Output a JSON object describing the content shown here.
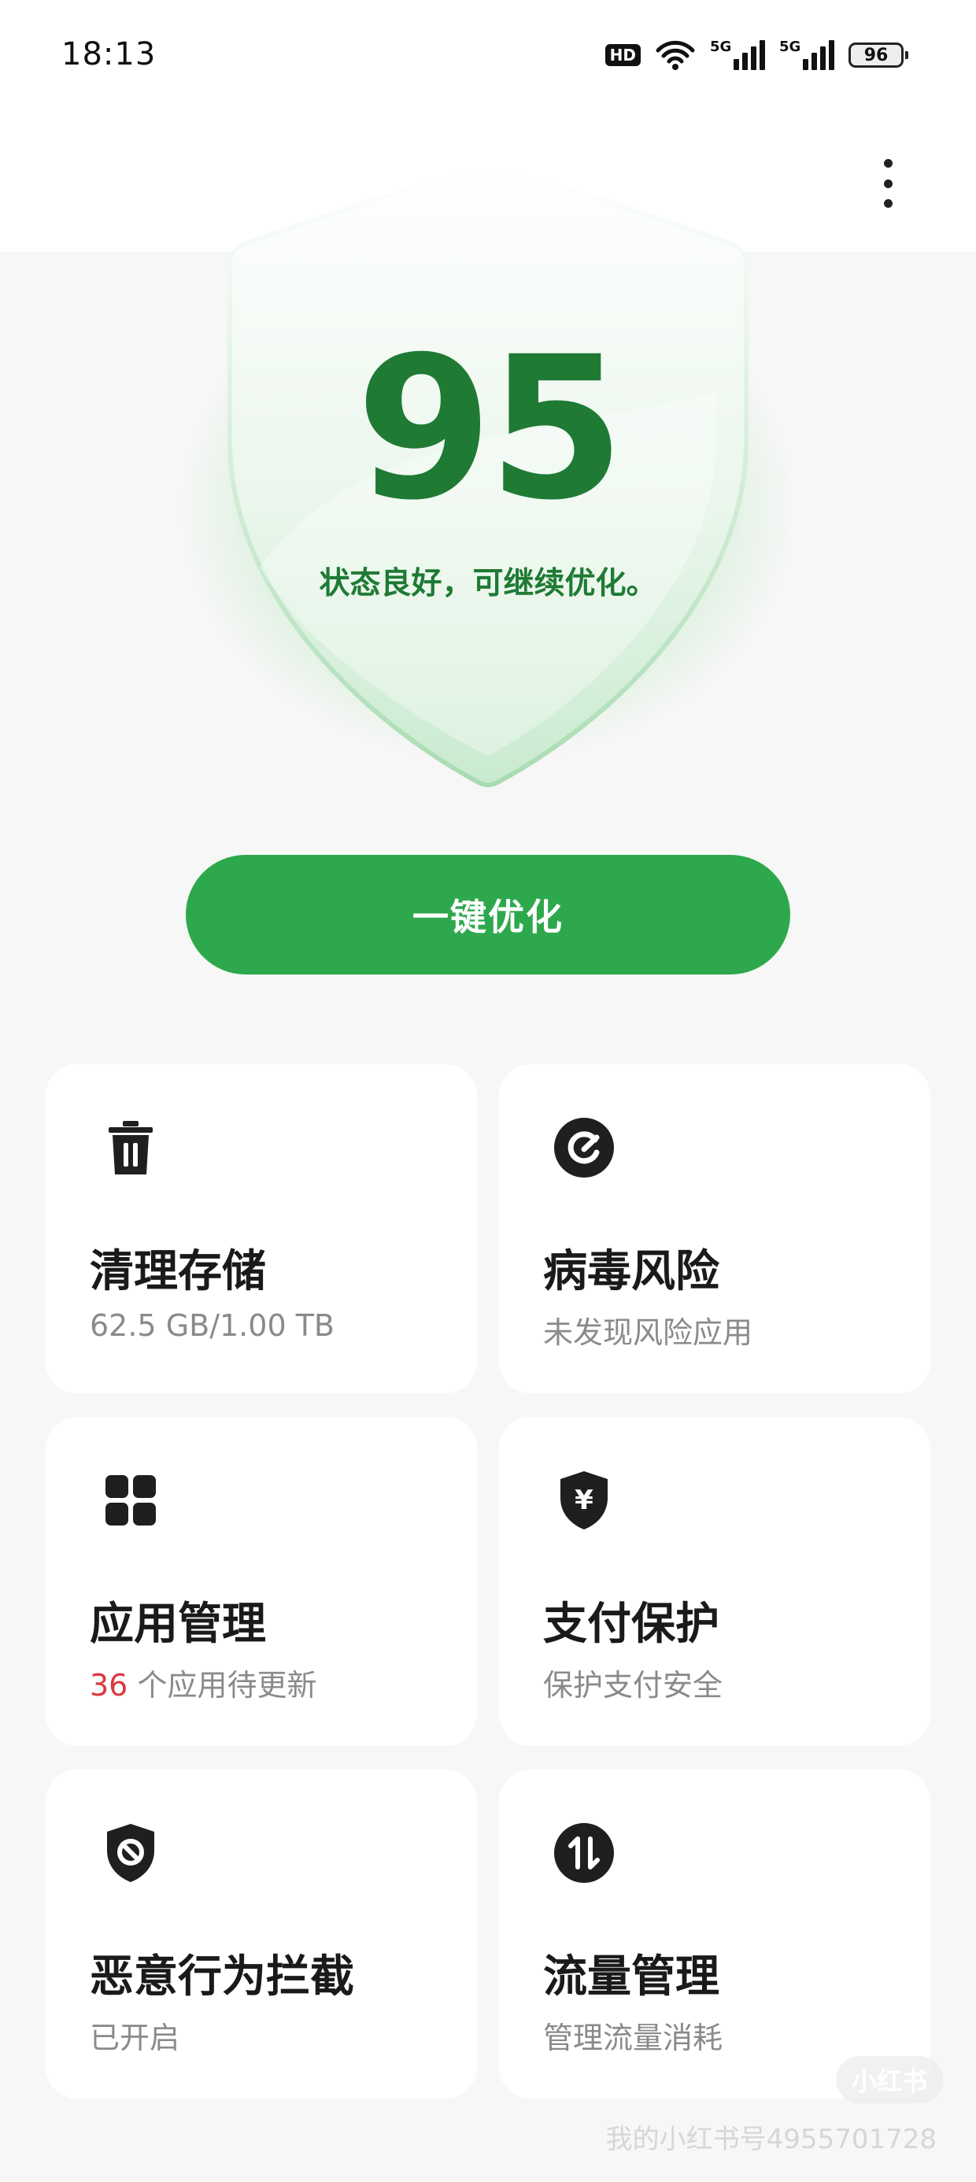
{
  "status_bar": {
    "time": "18:13",
    "hd_label": "HD",
    "network_1": "5G",
    "network_2": "5G",
    "battery": "96"
  },
  "shield": {
    "score": "95",
    "message": "状态良好，可继续优化。"
  },
  "optimize_button": {
    "label": "一键优化"
  },
  "cards": [
    {
      "title": "清理存储",
      "subtitle": "62.5 GB/1.00 TB",
      "icon": "trash-icon"
    },
    {
      "title": "病毒风险",
      "subtitle": "未发现风险应用",
      "icon": "virus-scan-icon"
    },
    {
      "title": "应用管理",
      "subtitle_count": "36",
      "subtitle": " 个应用待更新",
      "icon": "apps-grid-icon"
    },
    {
      "title": "支付保护",
      "subtitle": "保护支付安全",
      "icon": "payment-shield-icon"
    },
    {
      "title": "恶意行为拦截",
      "subtitle": "已开启",
      "icon": "block-shield-icon"
    },
    {
      "title": "流量管理",
      "subtitle": "管理流量消耗",
      "icon": "data-traffic-icon"
    }
  ],
  "watermark": {
    "logo": "小红书",
    "text": "我的小红书号4955701728"
  },
  "colors": {
    "accent": "#2ea84d",
    "score_green": "#1f7a34",
    "count_red": "#d9383f",
    "background": "#f7f7f7",
    "card": "#ffffff"
  }
}
